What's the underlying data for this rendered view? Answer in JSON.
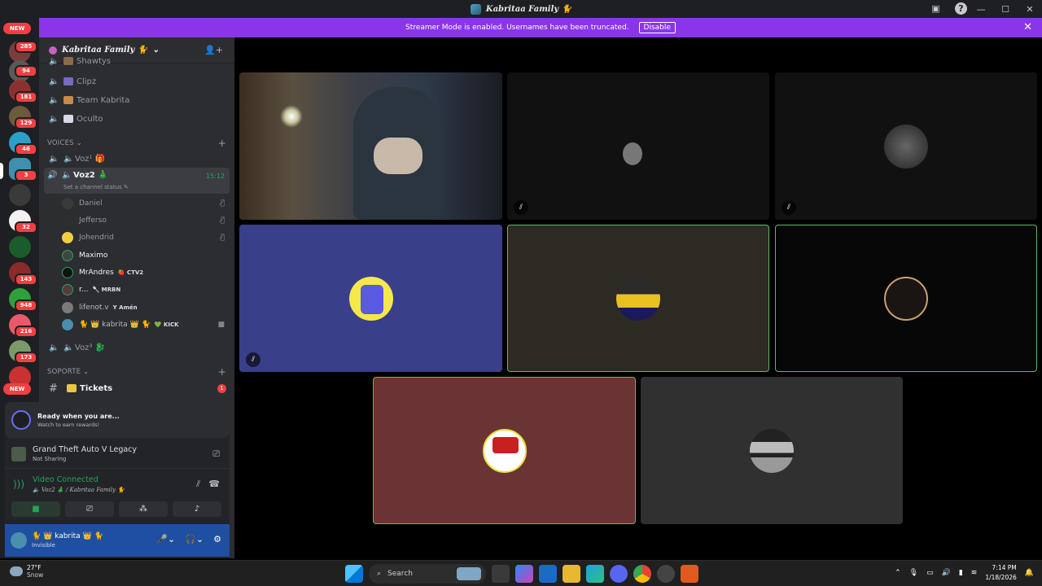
{
  "window": {
    "title": "Kabritaa Family 🐈",
    "controls": [
      "—",
      "☐",
      "✕"
    ]
  },
  "banner": {
    "text": "Streamer Mode is enabled. Usernames have been truncated.",
    "button": "Disable"
  },
  "servers": {
    "new_top": "NEW",
    "badges": [
      "285",
      "94",
      "181",
      "129",
      "46",
      "3",
      "32",
      "143",
      "948",
      "216",
      "173"
    ],
    "new_bottom": "NEW"
  },
  "sidebar": {
    "server_name": "Kabritaa Family 🐈",
    "text_channels": [
      {
        "name": "Shawtys"
      },
      {
        "name": "Clipz"
      },
      {
        "name": "Team Kabrita"
      },
      {
        "name": "Oculto"
      }
    ],
    "voices_category": "VOICES",
    "voice1": "Voz¹ 🎁",
    "voice2": "Voz2 🎄",
    "voice2_time": "15:12",
    "voice2_status": "Set a channel status ✎",
    "users": [
      {
        "name": "Daniel",
        "tag": "",
        "muted": true
      },
      {
        "name": "Jefferso",
        "tag": "",
        "muted": true
      },
      {
        "name": "Johendrid",
        "tag": "",
        "muted": true
      },
      {
        "name": "Maximo",
        "tag": "",
        "muted": false
      },
      {
        "name": "MrAndres",
        "tag": "🍓 CTV2",
        "muted": false
      },
      {
        "name": "r...",
        "tag": "🥄 MRBN",
        "muted": false
      },
      {
        "name": "lifenot.v",
        "tag": "Y Amén",
        "muted": false
      },
      {
        "name": "🐈 👑 kabrita 👑 🐈",
        "tag": "💚 KICK",
        "muted": false
      }
    ],
    "voice3": "Voz³ 🐉",
    "support_category": "SOPORTE",
    "tickets": "Tickets",
    "tickets_badge": "1"
  },
  "panel": {
    "quest_title": "Ready when you are...",
    "quest_sub": "Watch to earn rewards!",
    "activity_title": "Grand Theft Auto V Legacy",
    "activity_sub": "Not Sharing",
    "vc_title": "Video Connected",
    "vc_sub": "🔈 Voz2 🎄 / Kabritaa Family 🐈",
    "username": "🐈 👑 kabrita 👑 🐈",
    "status": "Invisible"
  },
  "taskbar": {
    "temp": "27°F",
    "weather": "Snow",
    "search": "Search",
    "time": "7:14 PM",
    "date": "1/18/2026"
  },
  "colors": {
    "accent": "#8a36e8",
    "connected": "#23a55a",
    "user_bar": "#1f4fa0"
  }
}
